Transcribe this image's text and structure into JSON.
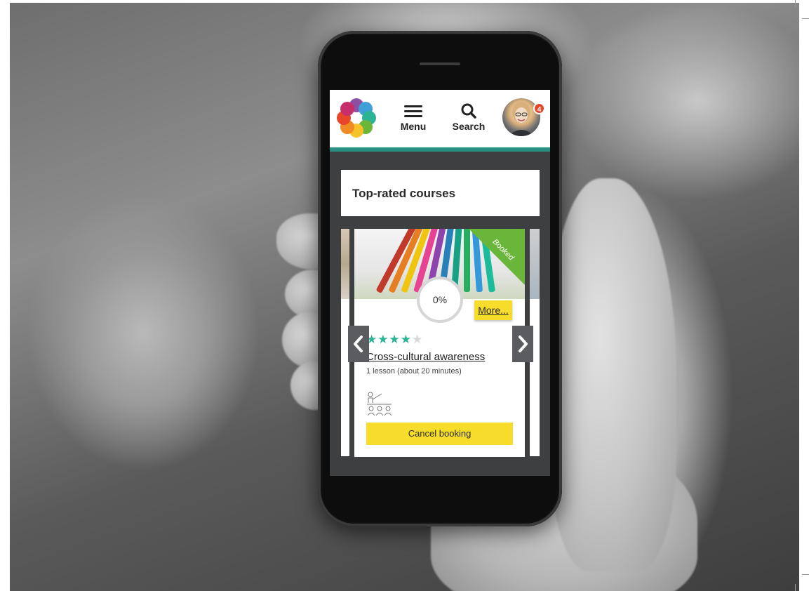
{
  "header": {
    "menu_label": "Menu",
    "search_label": "Search",
    "notification_count": "4",
    "accent_color": "#2a8f83"
  },
  "section": {
    "title": "Top-rated courses"
  },
  "course_card": {
    "ribbon_label": "Booked",
    "progress": "0%",
    "more_label": "More...",
    "rating": 4,
    "rating_max": 5,
    "title": "Cross-cultural awareness",
    "meta": "1 lesson (about 20 minutes)",
    "action_label": "Cancel booking",
    "button_color": "#f6dc2b",
    "star_color": "#2bb394",
    "ribbon_color": "#6ab63a"
  },
  "carousel": {
    "prev_icon": "chevron-left-icon",
    "next_icon": "chevron-right-icon"
  }
}
